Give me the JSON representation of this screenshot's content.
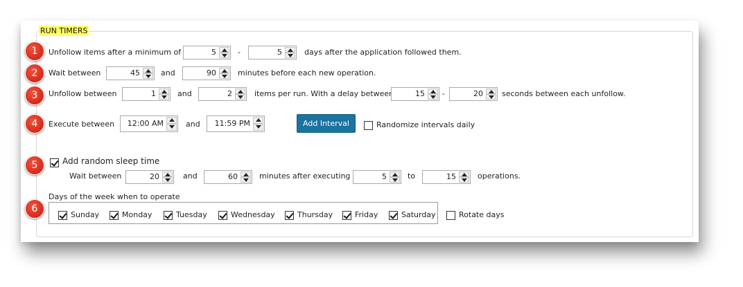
{
  "section_title": "RUN TIMERS",
  "badges": [
    "1",
    "2",
    "3",
    "4",
    "5",
    "6"
  ],
  "row1": {
    "label": "Unfollow items after a minimum of",
    "min_value": "5",
    "separator": "-",
    "max_value": "5",
    "suffix": "days after the application followed them."
  },
  "row2": {
    "label": "Wait between",
    "min_value": "45",
    "and": "and",
    "max_value": "90",
    "suffix": "minutes before each new operation."
  },
  "row3": {
    "label": "Unfollow between",
    "min_value": "1",
    "and": "and",
    "max_value": "2",
    "mid_text": "items per run. With a delay between",
    "delay_min": "15",
    "separator": "-",
    "delay_max": "20",
    "suffix": "seconds between each unfollow."
  },
  "row4": {
    "label": "Execute between",
    "start_time": "12:00 AM",
    "and": "and",
    "end_time": "11:59 PM",
    "add_interval_label": "Add Interval",
    "randomize_label": "Randomize intervals daily",
    "randomize_checked": false
  },
  "row5": {
    "checkbox_label": "Add random sleep time",
    "checked": true,
    "wait_label": "Wait between",
    "min_value": "20",
    "and": "and",
    "max_value": "60",
    "mid_text": "minutes after executing",
    "ops_min": "5",
    "to": "to",
    "ops_max": "15",
    "suffix": "operations."
  },
  "row6": {
    "label": "Days of the week when to operate",
    "days": [
      {
        "label": "Sunday",
        "checked": true
      },
      {
        "label": "Monday",
        "checked": true
      },
      {
        "label": "Tuesday",
        "checked": true
      },
      {
        "label": "Wednesday",
        "checked": true
      },
      {
        "label": "Thursday",
        "checked": true
      },
      {
        "label": "Friday",
        "checked": true
      },
      {
        "label": "Saturday",
        "checked": true
      }
    ],
    "rotate_label": "Rotate days",
    "rotate_checked": false
  }
}
